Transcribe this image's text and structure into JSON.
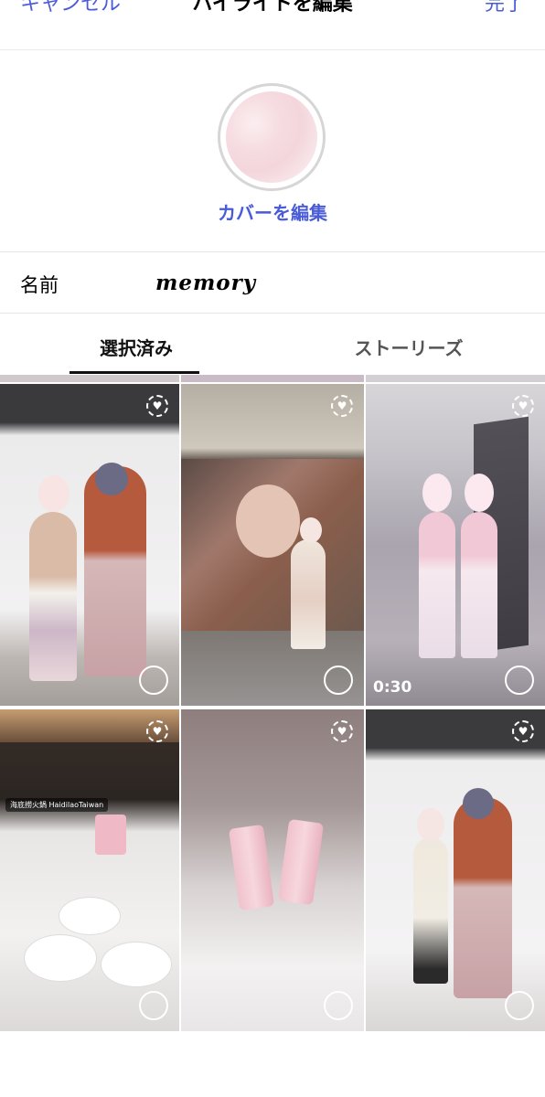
{
  "header": {
    "cancel_label": "キャンセル",
    "title": "ハイライトを編集",
    "done_label": "完了"
  },
  "cover": {
    "edit_label": "カバーを編集"
  },
  "name_field": {
    "label": "名前",
    "value": "memory"
  },
  "tabs": [
    {
      "label": "選択済み",
      "selected": true
    },
    {
      "label": "ストーリーズ",
      "selected": false
    }
  ],
  "grid": {
    "items": [
      {
        "kind": "photo",
        "selected": false
      },
      {
        "kind": "photo",
        "selected": false
      },
      {
        "kind": "video",
        "duration": "0:30",
        "selected": false
      },
      {
        "kind": "photo",
        "location_tag": "海底撈火鍋 HaidilaoTaiwan",
        "selected": false
      },
      {
        "kind": "photo",
        "selected": false
      },
      {
        "kind": "photo",
        "selected": false
      }
    ]
  },
  "colors": {
    "accent": "#4a5bd8",
    "text": "#000000",
    "divider": "#e6e6e6"
  }
}
